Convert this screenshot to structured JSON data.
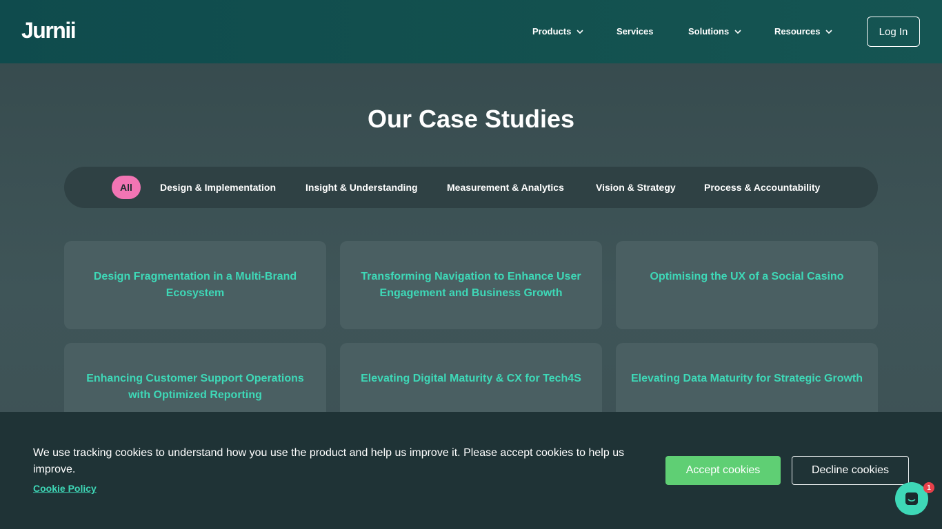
{
  "header": {
    "logo": "Jurnii",
    "nav": [
      {
        "label": "Products",
        "has_dropdown": true
      },
      {
        "label": "Services",
        "has_dropdown": false
      },
      {
        "label": "Solutions",
        "has_dropdown": true
      },
      {
        "label": "Resources",
        "has_dropdown": true
      }
    ],
    "login_label": "Log In"
  },
  "main": {
    "title": "Our Case Studies",
    "filters": {
      "active": "All",
      "items": [
        "Design & Implementation",
        "Insight & Understanding",
        "Measurement & Analytics",
        "Vision & Strategy",
        "Process & Accountability"
      ]
    },
    "cards": [
      "Design Fragmentation in a Multi-Brand Ecosystem",
      "Transforming Navigation to Enhance User Engagement and Business Growth",
      "Optimising the UX of a Social Casino",
      "Enhancing Customer Support Operations with Optimized Reporting",
      "Elevating Digital Maturity & CX for Tech4S",
      "Elevating Data Maturity for Strategic Growth"
    ]
  },
  "cookie_banner": {
    "text": "We use tracking cookies to understand how you use the product and help us improve it. Please accept cookies to help us improve.",
    "policy_link": "Cookie Policy",
    "accept_label": "Accept cookies",
    "decline_label": "Decline cookies"
  },
  "chat": {
    "icon": "chat-icon",
    "badge_count": "1"
  },
  "colors": {
    "accent_teal": "#3ed8b7",
    "active_pill": "#f275b4",
    "accept_green": "#5fcf74",
    "header_bg": "#13514f"
  }
}
